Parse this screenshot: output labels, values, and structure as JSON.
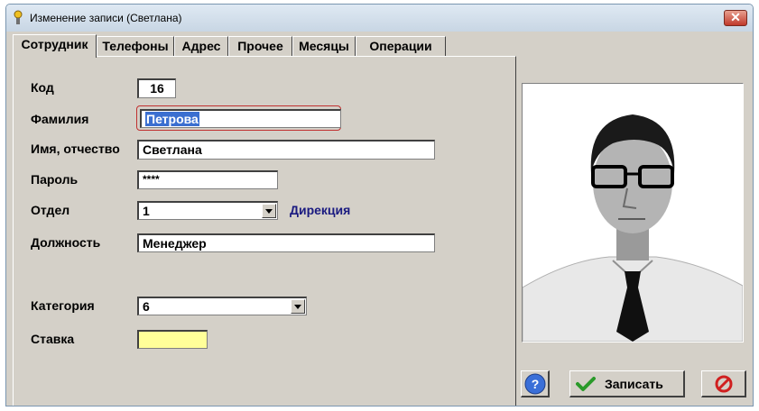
{
  "window": {
    "title": "Изменение записи  (Светлана)"
  },
  "tabs": [
    "Сотрудник",
    "Телефоны",
    "Адрес",
    "Прочее",
    "Месяцы",
    "Операции"
  ],
  "form": {
    "code_label": "Код",
    "code_value": "16",
    "surname_label": "Фамилия",
    "surname_value": "Петрова",
    "name_label": "Имя, отчество",
    "name_value": "Светлана",
    "password_label": "Пароль",
    "password_value": "****",
    "department_label": "Отдел",
    "department_value": "1",
    "department_name": "Дирекция",
    "position_label": "Должность",
    "position_value": "Менеджер",
    "category_label": "Категория",
    "category_value": "6",
    "rate_label": "Ставка",
    "rate_value": ""
  },
  "buttons": {
    "save_label": "Записать"
  },
  "colors": {
    "department_name": "#1a1a80",
    "rate_field": "#ffff99",
    "selection": "#3b6fd0"
  }
}
